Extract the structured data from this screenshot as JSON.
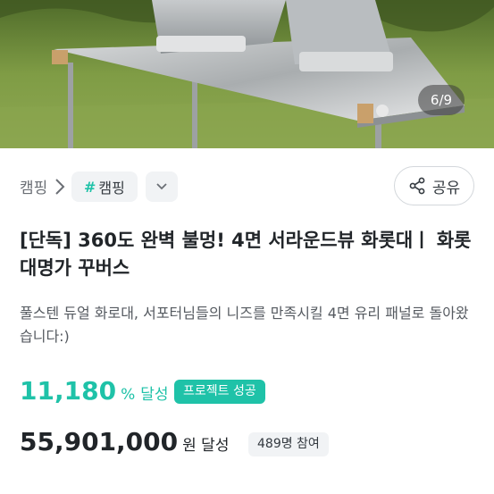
{
  "hero": {
    "counter": "6/9"
  },
  "breadcrumb": {
    "category": "캠핑",
    "tag_hash": "#",
    "tag": "캠핑"
  },
  "share": {
    "label": "공유"
  },
  "project": {
    "title": "[단독] 360도 완벽 불멍! 4면 서라운드뷰 화롯대ㅣ 화롯대명가 꾸버스",
    "description": "풀스텐 듀얼 화로대, 서포터님들의 니즈를 만족시킬 4면 유리 패널로 돌아왔습니다:)",
    "achievement_rate": "11,180",
    "rate_unit": "%",
    "rate_label": "달성",
    "status_badge": "프로젝트 성공",
    "amount": "55,901,000",
    "amount_unit": "원 달성",
    "participants": "489명 참여"
  },
  "colors": {
    "accent": "#1fc2a8",
    "text": "#212529",
    "muted": "#555a60"
  }
}
